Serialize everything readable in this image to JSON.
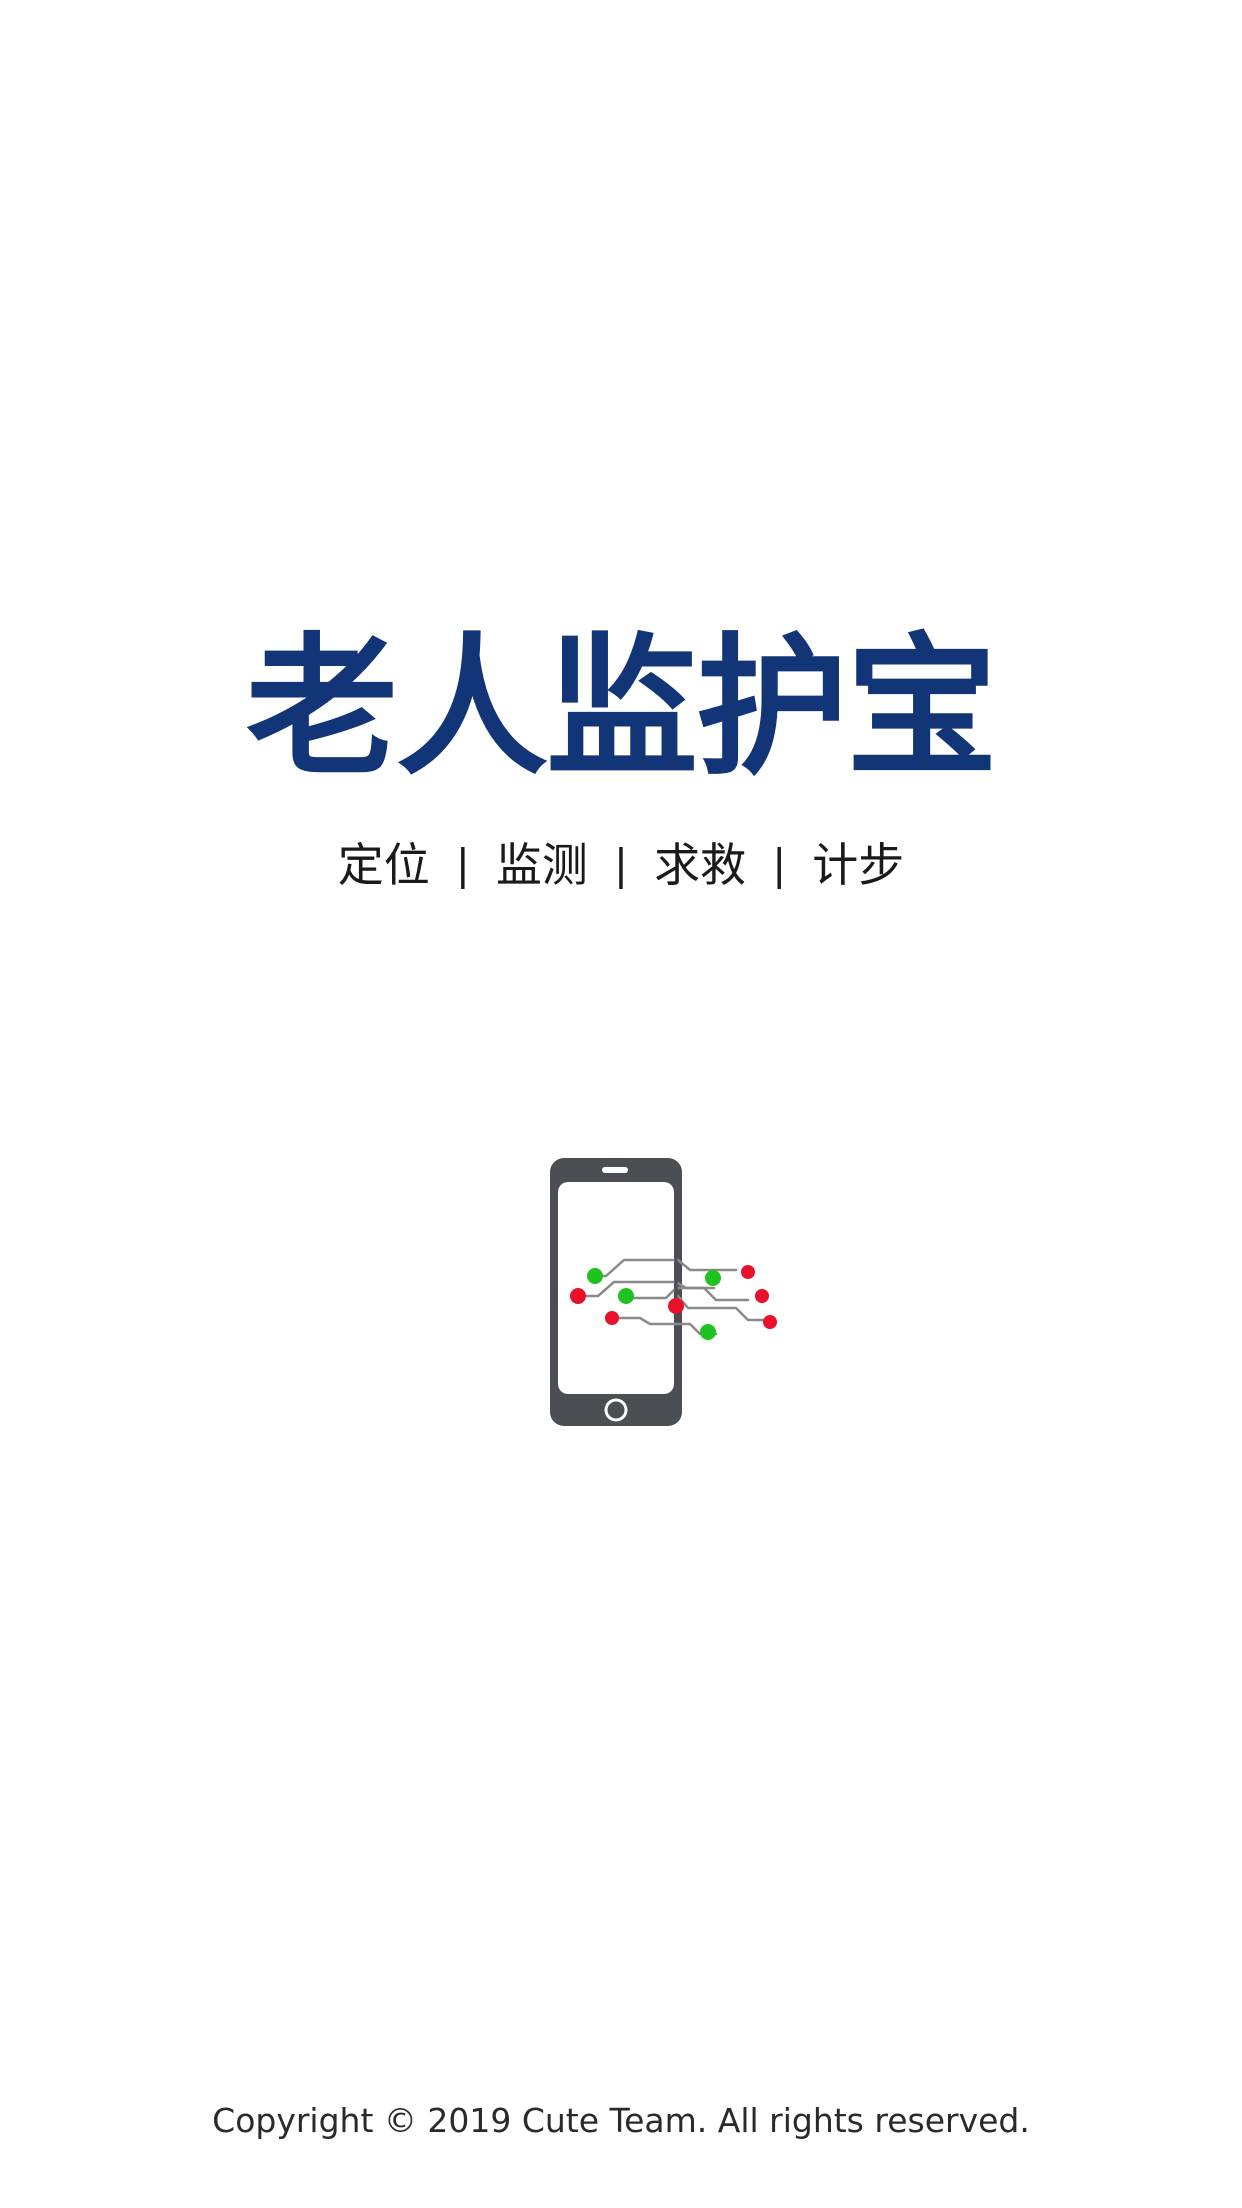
{
  "app": {
    "title": "老人监护宝"
  },
  "features": [
    {
      "label": "定位"
    },
    {
      "label": "监测"
    },
    {
      "label": "求救"
    },
    {
      "label": "计步"
    }
  ],
  "separator": "|",
  "illustration": {
    "icon": "phone-network-icon",
    "colors": {
      "phone": "#4b4f54",
      "active_node": "#1fc31f",
      "alert_node": "#e8102a",
      "wire": "#8a8a8a"
    }
  },
  "footer": {
    "copyright": "Copyright © 2019 Cute Team. All rights reserved."
  },
  "theme": {
    "brand": "#123577"
  }
}
